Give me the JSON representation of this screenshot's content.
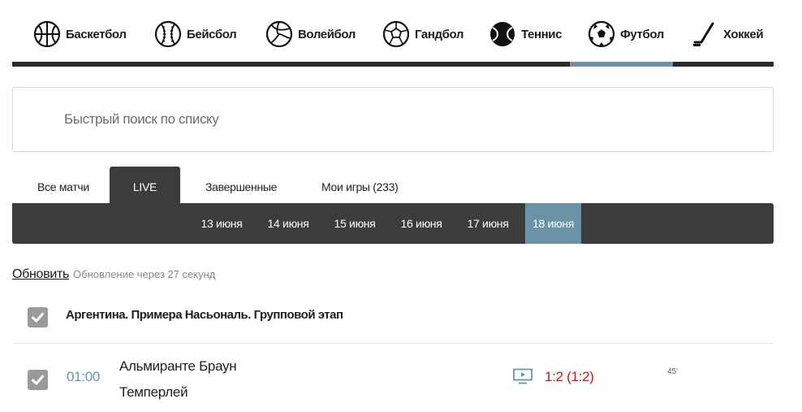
{
  "sports": [
    {
      "label": "Баскетбол",
      "icon": "basketball-icon"
    },
    {
      "label": "Бейсбол",
      "icon": "baseball-icon"
    },
    {
      "label": "Волейбол",
      "icon": "volleyball-icon"
    },
    {
      "label": "Гандбол",
      "icon": "handball-icon"
    },
    {
      "label": "Теннис",
      "icon": "tennis-icon"
    },
    {
      "label": "Футбол",
      "icon": "football-icon",
      "active": true
    },
    {
      "label": "Хоккей",
      "icon": "hockey-icon"
    }
  ],
  "search": {
    "placeholder": "Быстрый поиск по списку",
    "value": ""
  },
  "tabs": [
    {
      "label": "Все матчи"
    },
    {
      "label": "LIVE",
      "active": true
    },
    {
      "label": "Завершенные"
    },
    {
      "label": "Мои игры (233)"
    }
  ],
  "dates": [
    {
      "label": "13 июня"
    },
    {
      "label": "14 июня"
    },
    {
      "label": "15 июня"
    },
    {
      "label": "16 июня"
    },
    {
      "label": "17 июня"
    },
    {
      "label": "18 июня",
      "active": true
    }
  ],
  "refresh": {
    "link": "Обновить",
    "note": "Обновление через 27 секунд"
  },
  "league": {
    "name": "Аргентина. Примера Насьональ. Групповой этап",
    "checked": true
  },
  "match": {
    "time": "01:00",
    "team1": "Альмиранте Браун",
    "team2": "Темперлей",
    "score": "1:2 (1:2)",
    "minute": "45'",
    "checked": true,
    "tv_icon": "tv-broadcast-icon"
  },
  "colors": {
    "accent": "#6a93a8",
    "dark": "#3c3c3c",
    "score": "#c8141c",
    "checkbox": "#9a9a9a"
  }
}
